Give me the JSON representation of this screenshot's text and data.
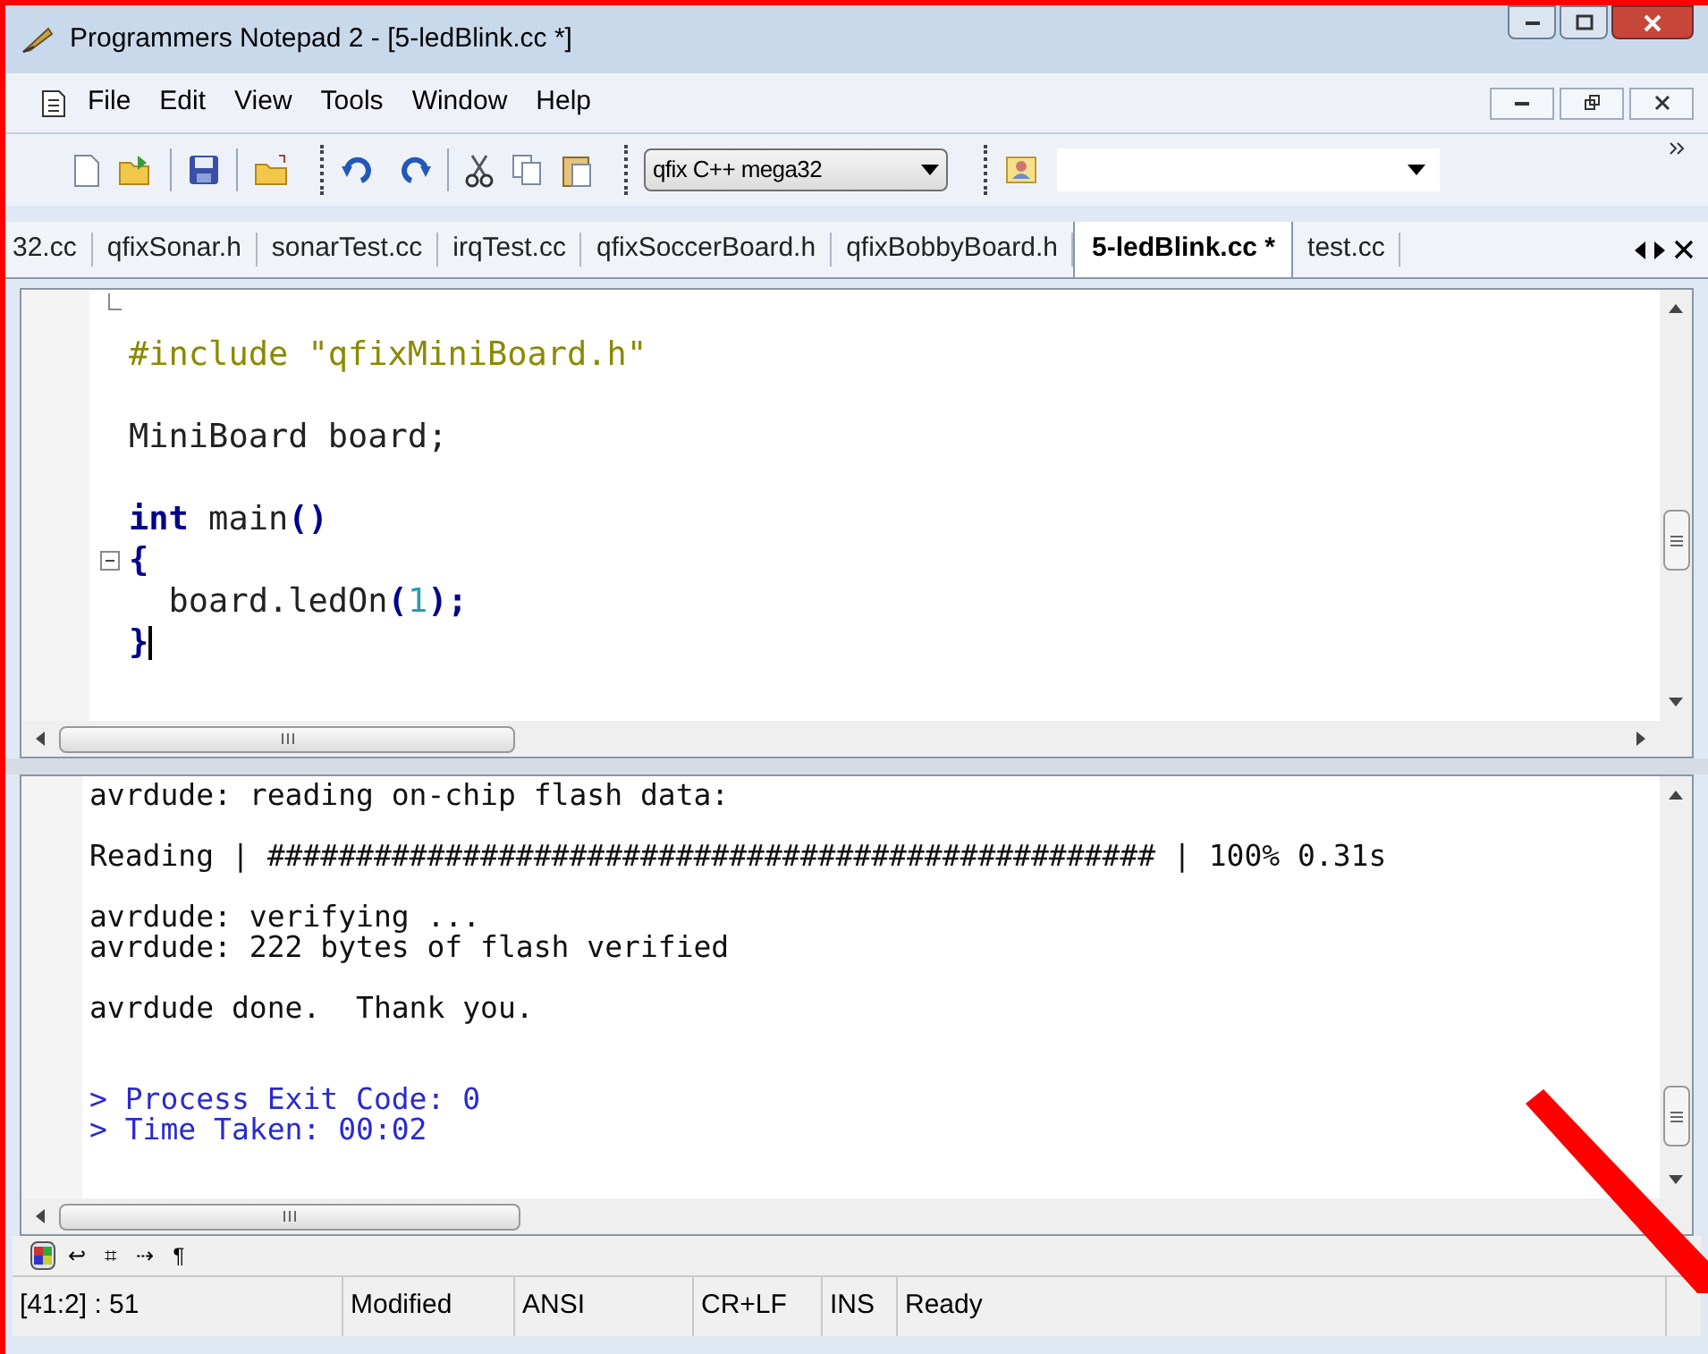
{
  "window": {
    "title": "Programmers Notepad 2 - [5-ledBlink.cc *]"
  },
  "menu": [
    "File",
    "Edit",
    "View",
    "Tools",
    "Window",
    "Help"
  ],
  "toolbar": {
    "scheme_dropdown": {
      "value": "qfix C++ mega32"
    }
  },
  "tabs": [
    {
      "label": "32.cc",
      "selected": false
    },
    {
      "label": "qfixSonar.h",
      "selected": false
    },
    {
      "label": "sonarTest.cc",
      "selected": false
    },
    {
      "label": "irqTest.cc",
      "selected": false
    },
    {
      "label": "qfixSoccerBoard.h",
      "selected": false
    },
    {
      "label": "qfixBobbyBoard.h",
      "selected": false
    },
    {
      "label": "5-ledBlink.cc *",
      "selected": true
    },
    {
      "label": "test.cc",
      "selected": false
    }
  ],
  "editor": {
    "lines": [
      {
        "fold_end": true
      },
      {
        "tokens": [
          {
            "kind": "preprocessor",
            "text": "#include \"qfixMiniBoard.h\""
          }
        ]
      },
      {
        "fold_end": false
      },
      {
        "tokens": [
          {
            "kind": "plain",
            "text": "MiniBoard board;"
          }
        ]
      },
      {
        "fold_end": false
      },
      {
        "tokens": [
          {
            "kind": "keyword",
            "text": "int"
          },
          {
            "kind": "plain",
            "text": " main"
          },
          {
            "kind": "operator",
            "text": "()"
          }
        ]
      },
      {
        "fold_open": true,
        "tokens": [
          {
            "kind": "operator",
            "text": "{"
          }
        ]
      },
      {
        "tokens": [
          {
            "kind": "plain",
            "text": "  board.ledOn"
          },
          {
            "kind": "operator",
            "text": "("
          },
          {
            "kind": "number",
            "text": "1"
          },
          {
            "kind": "operator",
            "text": ");"
          }
        ]
      },
      {
        "cursor": true,
        "tokens": [
          {
            "kind": "operator",
            "text": "}"
          }
        ]
      },
      {
        "fold_end": false
      }
    ]
  },
  "output": {
    "lines": [
      {
        "kind": "plain",
        "text": "avrdude: reading on-chip flash data:"
      },
      {
        "kind": "blank"
      },
      {
        "kind": "plain",
        "text": "Reading | ################################################## | 100% 0.31s"
      },
      {
        "kind": "blank"
      },
      {
        "kind": "plain",
        "text": "avrdude: verifying ..."
      },
      {
        "kind": "plain",
        "text": "avrdude: 222 bytes of flash verified"
      },
      {
        "kind": "blank"
      },
      {
        "kind": "plain",
        "text": "avrdude done.  Thank you."
      },
      {
        "kind": "blank"
      },
      {
        "kind": "blank"
      },
      {
        "kind": "info",
        "text": "> Process Exit Code: 0"
      },
      {
        "kind": "info",
        "text": "> Time Taken: 00:02"
      }
    ]
  },
  "view_toggles": [
    {
      "kind": "colours",
      "selected": true
    },
    {
      "kind": "glyph",
      "text": "↩",
      "selected": false
    },
    {
      "kind": "glyph",
      "text": "⌗",
      "selected": false
    },
    {
      "kind": "glyph",
      "text": "⇢",
      "selected": false
    },
    {
      "kind": "glyph",
      "text": "¶",
      "selected": false
    }
  ],
  "status_bar": [
    "[41:2] : 51",
    "Modified",
    "ANSI",
    "CR+LF",
    "INS",
    "Ready"
  ]
}
